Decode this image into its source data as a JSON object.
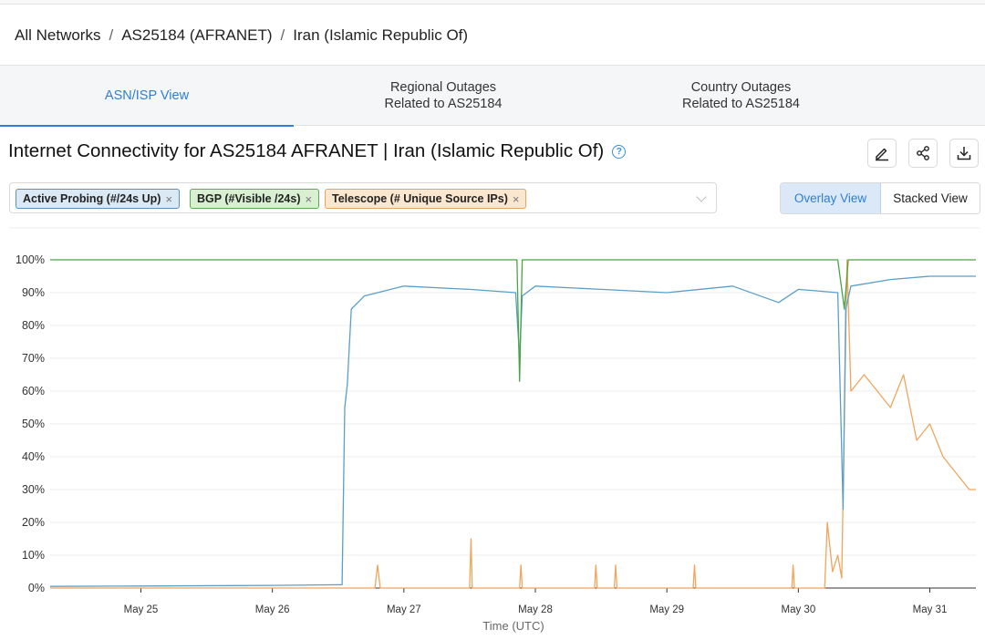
{
  "breadcrumb": {
    "items": [
      "All Networks",
      "AS25184 (AFRANET)",
      "Iran (Islamic Republic Of)"
    ],
    "separator": "/"
  },
  "tabs": [
    {
      "line1": "ASN/ISP View",
      "line2": ""
    },
    {
      "line1": "Regional Outages",
      "line2": "Related to AS25184"
    },
    {
      "line1": "Country Outages",
      "line2": "Related to AS25184"
    }
  ],
  "title": "Internet Connectivity for AS25184 AFRANET | Iran (Islamic Republic Of)",
  "toolbar": {
    "icons": [
      "edit-icon",
      "share-icon",
      "download-icon"
    ]
  },
  "filters": {
    "tags": [
      "Active Probing (#/24s Up)",
      "BGP (#Visible /24s)",
      "Telescope (# Unique Source IPs)"
    ],
    "remove_glyph": "×"
  },
  "views": {
    "overlay": "Overlay View",
    "stacked": "Stacked View",
    "selected": "Overlay View"
  },
  "colors": {
    "accent": "#2e7fd5",
    "active_probing": "#5a9fc9",
    "bgp": "#4aa446",
    "telescope": "#f0a55d"
  },
  "chart_data": {
    "type": "line",
    "xlabel": "Time (UTC)",
    "x_ticks": [
      "May 25",
      "May 26",
      "May 27",
      "May 28",
      "May 29",
      "May 30",
      "May 31"
    ],
    "y_ticks": [
      "0%",
      "10%",
      "20%",
      "30%",
      "40%",
      "50%",
      "60%",
      "70%",
      "80%",
      "90%",
      "100%"
    ],
    "ylim": [
      0,
      100
    ],
    "xlim_days": [
      24.31,
      31.35
    ],
    "grid": true,
    "series": [
      {
        "name": "Active Probing (#/24s Up)",
        "color": "#5a9fc9",
        "points": [
          [
            24.31,
            0.5
          ],
          [
            25.0,
            0.6
          ],
          [
            26.0,
            0.8
          ],
          [
            26.5,
            1.0
          ],
          [
            26.53,
            1
          ],
          [
            26.55,
            55
          ],
          [
            26.57,
            62
          ],
          [
            26.6,
            85
          ],
          [
            26.7,
            89
          ],
          [
            27.0,
            92
          ],
          [
            27.5,
            91
          ],
          [
            27.85,
            90
          ],
          [
            27.88,
            70
          ],
          [
            27.9,
            89
          ],
          [
            28.0,
            92
          ],
          [
            28.5,
            91
          ],
          [
            29.0,
            90
          ],
          [
            29.5,
            92
          ],
          [
            29.85,
            87
          ],
          [
            30.0,
            91
          ],
          [
            30.3,
            90
          ],
          [
            30.34,
            24
          ],
          [
            30.36,
            85
          ],
          [
            30.4,
            92
          ],
          [
            30.7,
            94
          ],
          [
            31.0,
            95
          ],
          [
            31.35,
            95
          ]
        ]
      },
      {
        "name": "BGP (#Visible /24s)",
        "color": "#4aa446",
        "points": [
          [
            24.31,
            100
          ],
          [
            27.86,
            100
          ],
          [
            27.88,
            63
          ],
          [
            27.9,
            100
          ],
          [
            30.3,
            100
          ],
          [
            30.35,
            85
          ],
          [
            30.38,
            100
          ],
          [
            31.35,
            100
          ]
        ]
      },
      {
        "name": "Telescope (# Unique Source IPs)",
        "color": "#f0a55d",
        "points": [
          [
            24.31,
            0
          ],
          [
            26.78,
            0
          ],
          [
            26.8,
            7
          ],
          [
            26.82,
            0
          ],
          [
            27.5,
            0
          ],
          [
            27.51,
            15
          ],
          [
            27.52,
            0
          ],
          [
            27.88,
            0
          ],
          [
            27.89,
            7
          ],
          [
            27.9,
            0
          ],
          [
            28.45,
            0
          ],
          [
            28.46,
            7
          ],
          [
            28.47,
            0
          ],
          [
            28.6,
            0
          ],
          [
            28.61,
            7
          ],
          [
            28.62,
            0
          ],
          [
            29.2,
            0
          ],
          [
            29.21,
            7
          ],
          [
            29.22,
            0
          ],
          [
            29.95,
            0
          ],
          [
            29.96,
            7
          ],
          [
            29.97,
            0
          ],
          [
            30.2,
            0
          ],
          [
            30.22,
            20
          ],
          [
            30.26,
            5
          ],
          [
            30.3,
            10
          ],
          [
            30.33,
            3
          ],
          [
            30.37,
            100
          ],
          [
            30.4,
            60
          ],
          [
            30.5,
            65
          ],
          [
            30.7,
            55
          ],
          [
            30.8,
            65
          ],
          [
            30.9,
            45
          ],
          [
            31.0,
            50
          ],
          [
            31.1,
            40
          ],
          [
            31.2,
            35
          ],
          [
            31.3,
            30
          ],
          [
            31.35,
            30
          ]
        ]
      }
    ]
  }
}
